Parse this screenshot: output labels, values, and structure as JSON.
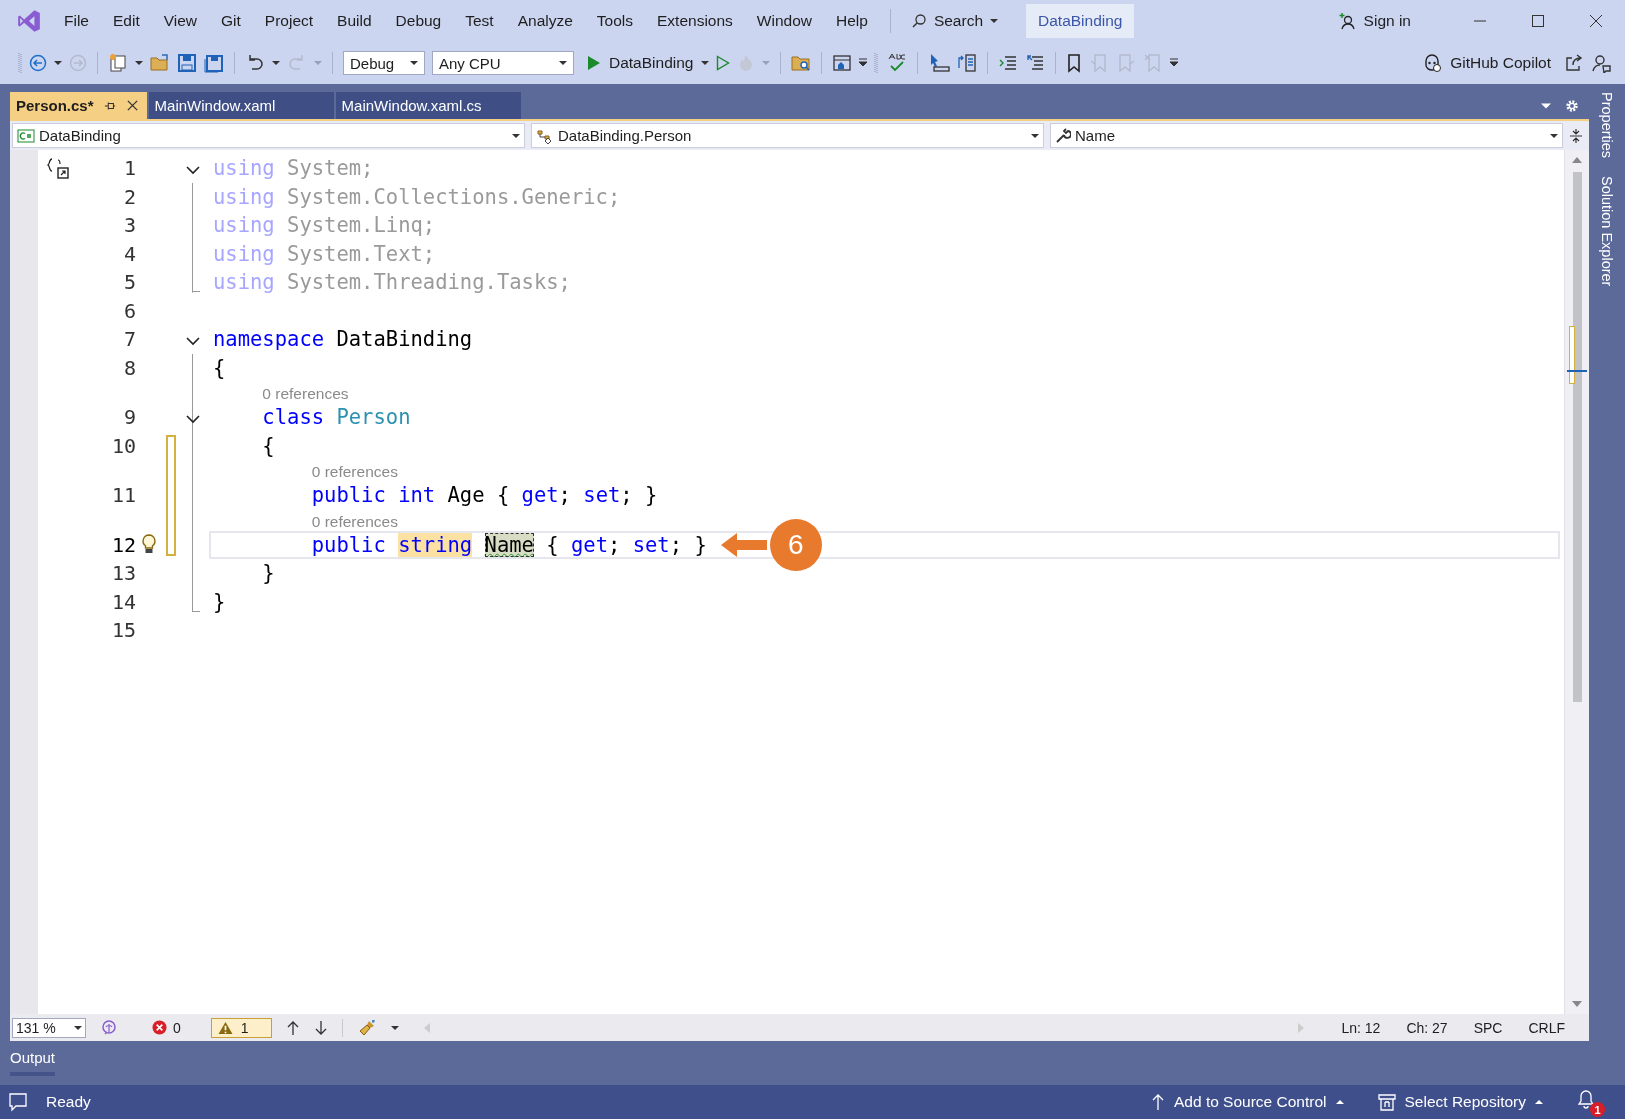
{
  "menu": [
    "File",
    "Edit",
    "View",
    "Git",
    "Project",
    "Build",
    "Debug",
    "Test",
    "Analyze",
    "Tools",
    "Extensions",
    "Window",
    "Help"
  ],
  "search": "Search",
  "solution": "DataBinding",
  "sign_in": "Sign in",
  "toolbar": {
    "configuration": "Debug",
    "platform": "Any CPU",
    "startup": "DataBinding",
    "copilot": "GitHub Copilot"
  },
  "tabs": [
    {
      "label": "Person.cs*",
      "selected": true
    },
    {
      "label": "MainWindow.xaml",
      "selected": false
    },
    {
      "label": "MainWindow.xaml.cs",
      "selected": false
    }
  ],
  "navigation": [
    {
      "kind": "project",
      "label": "DataBinding"
    },
    {
      "kind": "class",
      "label": "DataBinding.Person"
    },
    {
      "kind": "member",
      "label": "Name"
    }
  ],
  "side_tabs": [
    "Properties",
    "Solution Explorer"
  ],
  "editor": {
    "lines": [
      {
        "number": "1",
        "collapsible": true,
        "unused": true,
        "tokens": [
          {
            "text": "using",
            "kind": "keyword"
          },
          {
            "text": " System;",
            "kind": "plain"
          }
        ]
      },
      {
        "number": "2",
        "in_region": true,
        "unused": true,
        "tokens": [
          {
            "text": "using",
            "kind": "keyword"
          },
          {
            "text": " System.Collections.Generic;",
            "kind": "plain"
          }
        ]
      },
      {
        "number": "3",
        "in_region": true,
        "unused": true,
        "tokens": [
          {
            "text": "using",
            "kind": "keyword"
          },
          {
            "text": " System.Linq;",
            "kind": "plain"
          }
        ]
      },
      {
        "number": "4",
        "in_region": true,
        "unused": true,
        "tokens": [
          {
            "text": "using",
            "kind": "keyword"
          },
          {
            "text": " System.Text;",
            "kind": "plain"
          }
        ]
      },
      {
        "number": "5",
        "region_end": true,
        "unused": true,
        "tokens": [
          {
            "text": "using",
            "kind": "keyword"
          },
          {
            "text": " System.Threading.Tasks;",
            "kind": "plain"
          }
        ]
      },
      {
        "number": "6"
      },
      {
        "number": "7",
        "collapsible": true,
        "tokens": [
          {
            "text": "namespace",
            "kind": "keyword"
          },
          {
            "text": " DataBinding",
            "kind": "plain"
          }
        ]
      },
      {
        "number": "8",
        "in_region": true,
        "tokens": [
          {
            "text": "{",
            "kind": "plain"
          }
        ]
      },
      {
        "number": "9",
        "collapsible": true,
        "in_region": true,
        "codelens": "0 references",
        "tokens": [
          {
            "text": "    class",
            "kind": "keyword"
          },
          {
            "text": " Person",
            "kind": "type"
          }
        ]
      },
      {
        "number": "10",
        "in_region": true,
        "modified": true,
        "tokens": [
          {
            "text": "    {",
            "kind": "plain"
          }
        ]
      },
      {
        "number": "11",
        "in_region": true,
        "modified": true,
        "codelens": "0 references",
        "tokens": [
          {
            "text": "        public int",
            "kind": "keyword"
          },
          {
            "text": " Age { ",
            "kind": "plain"
          },
          {
            "text": "get",
            "kind": "keyword"
          },
          {
            "text": "; ",
            "kind": "plain"
          },
          {
            "text": "set",
            "kind": "keyword"
          },
          {
            "text": "; }",
            "kind": "plain"
          }
        ]
      },
      {
        "number": "12",
        "in_region": true,
        "modified": true,
        "current": true,
        "lightbulb": true,
        "codelens": "0 references",
        "callout": "6",
        "tokens": [
          {
            "text": "        public",
            "kind": "keyword"
          },
          {
            "text": " string",
            "kind": "keyword",
            "referenced": true
          },
          {
            "text": " Name",
            "kind": "plain",
            "renaming": true
          },
          {
            "text": " { ",
            "kind": "plain"
          },
          {
            "text": "get",
            "kind": "keyword"
          },
          {
            "text": "; ",
            "kind": "plain"
          },
          {
            "text": "set",
            "kind": "keyword"
          },
          {
            "text": "; }",
            "kind": "plain"
          }
        ]
      },
      {
        "number": "13",
        "in_region": true,
        "tokens": [
          {
            "text": "    }",
            "kind": "plain"
          }
        ]
      },
      {
        "number": "14",
        "region_end": true,
        "tokens": [
          {
            "text": "}",
            "kind": "plain"
          }
        ]
      },
      {
        "number": "15"
      }
    ]
  },
  "editor_footer": {
    "zoom": "131 %",
    "errors": "0",
    "warnings": "1",
    "line": "Ln: 12",
    "column": "Ch: 27",
    "whitespace": "SPC",
    "line_endings": "CRLF"
  },
  "bottom_panel": "Output",
  "status_bar": {
    "message": "Ready",
    "source_control": "Add to Source Control",
    "repository": "Select Repository",
    "notifications": "1"
  }
}
